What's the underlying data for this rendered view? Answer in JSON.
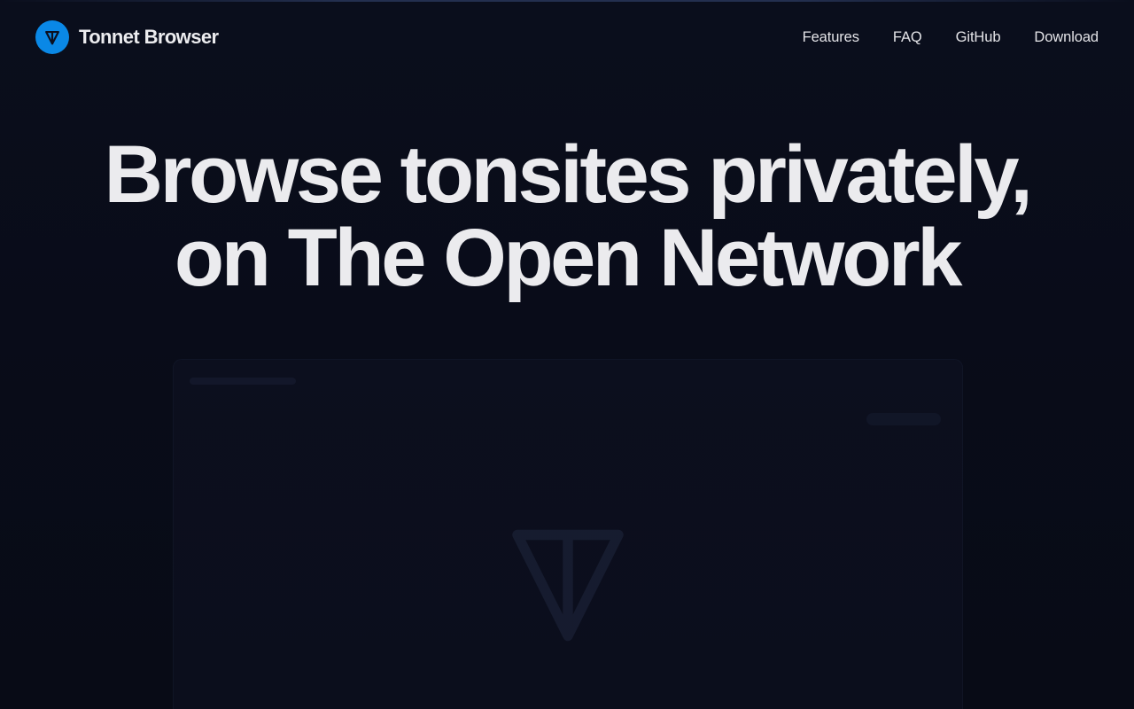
{
  "brand": {
    "name": "Tonnet Browser",
    "logo_icon": "ton-diamond-icon",
    "logo_color": "#0a88e6"
  },
  "nav": {
    "items": [
      {
        "label": "Features"
      },
      {
        "label": "FAQ"
      },
      {
        "label": "GitHub"
      },
      {
        "label": "Download"
      }
    ]
  },
  "hero": {
    "line1": "Browse tonsites privately,",
    "line2": "on The Open Network"
  },
  "colors": {
    "background": "#0a0d1a",
    "text": "#ebebee",
    "accent": "#0a88e6"
  }
}
